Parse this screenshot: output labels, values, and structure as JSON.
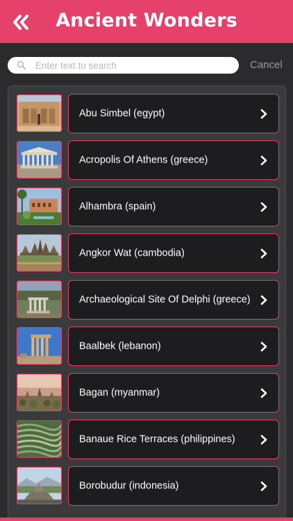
{
  "header": {
    "title": "Ancient Wonders",
    "back_icon": "double-chevron-left-icon",
    "color": "#e5416b"
  },
  "search": {
    "placeholder": "Enter text to search",
    "value": "",
    "cancel_label": "Cancel"
  },
  "list": {
    "items": [
      {
        "label": "Abu Simbel (egypt)",
        "thumb_icon": "abu-simbel-thumbnail"
      },
      {
        "label": "Acropolis Of Athens (greece)",
        "thumb_icon": "acropolis-thumbnail"
      },
      {
        "label": "Alhambra (spain)",
        "thumb_icon": "alhambra-thumbnail"
      },
      {
        "label": "Angkor Wat (cambodia)",
        "thumb_icon": "angkor-wat-thumbnail"
      },
      {
        "label": "Archaeological Site Of Delphi (greece)",
        "thumb_icon": "delphi-thumbnail"
      },
      {
        "label": "Baalbek (lebanon)",
        "thumb_icon": "baalbek-thumbnail"
      },
      {
        "label": "Bagan (myanmar)",
        "thumb_icon": "bagan-thumbnail"
      },
      {
        "label": "Banaue Rice Terraces (philippines)",
        "thumb_icon": "banaue-thumbnail"
      },
      {
        "label": "Borobudur (indonesia)",
        "thumb_icon": "borobudur-thumbnail"
      }
    ]
  }
}
